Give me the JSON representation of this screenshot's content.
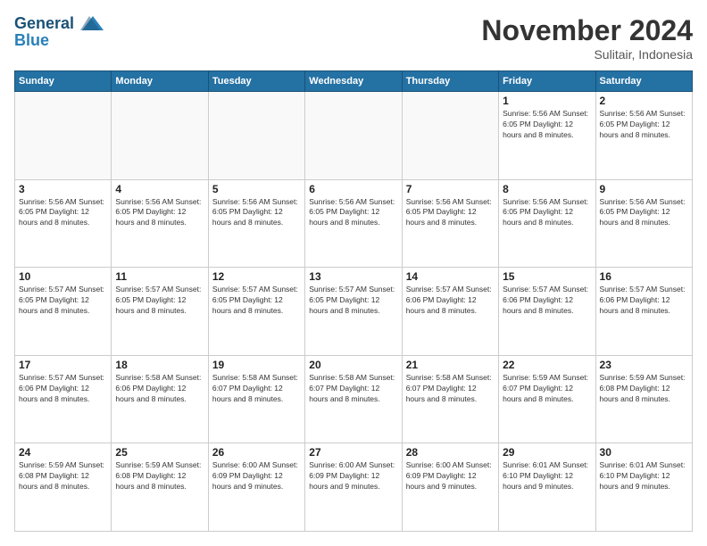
{
  "header": {
    "logo_line1": "General",
    "logo_line2": "Blue",
    "month": "November 2024",
    "location": "Sulitair, Indonesia"
  },
  "weekdays": [
    "Sunday",
    "Monday",
    "Tuesday",
    "Wednesday",
    "Thursday",
    "Friday",
    "Saturday"
  ],
  "weeks": [
    [
      {
        "day": "",
        "info": ""
      },
      {
        "day": "",
        "info": ""
      },
      {
        "day": "",
        "info": ""
      },
      {
        "day": "",
        "info": ""
      },
      {
        "day": "",
        "info": ""
      },
      {
        "day": "1",
        "info": "Sunrise: 5:56 AM\nSunset: 6:05 PM\nDaylight: 12 hours and 8 minutes."
      },
      {
        "day": "2",
        "info": "Sunrise: 5:56 AM\nSunset: 6:05 PM\nDaylight: 12 hours and 8 minutes."
      }
    ],
    [
      {
        "day": "3",
        "info": "Sunrise: 5:56 AM\nSunset: 6:05 PM\nDaylight: 12 hours and 8 minutes."
      },
      {
        "day": "4",
        "info": "Sunrise: 5:56 AM\nSunset: 6:05 PM\nDaylight: 12 hours and 8 minutes."
      },
      {
        "day": "5",
        "info": "Sunrise: 5:56 AM\nSunset: 6:05 PM\nDaylight: 12 hours and 8 minutes."
      },
      {
        "day": "6",
        "info": "Sunrise: 5:56 AM\nSunset: 6:05 PM\nDaylight: 12 hours and 8 minutes."
      },
      {
        "day": "7",
        "info": "Sunrise: 5:56 AM\nSunset: 6:05 PM\nDaylight: 12 hours and 8 minutes."
      },
      {
        "day": "8",
        "info": "Sunrise: 5:56 AM\nSunset: 6:05 PM\nDaylight: 12 hours and 8 minutes."
      },
      {
        "day": "9",
        "info": "Sunrise: 5:56 AM\nSunset: 6:05 PM\nDaylight: 12 hours and 8 minutes."
      }
    ],
    [
      {
        "day": "10",
        "info": "Sunrise: 5:57 AM\nSunset: 6:05 PM\nDaylight: 12 hours and 8 minutes."
      },
      {
        "day": "11",
        "info": "Sunrise: 5:57 AM\nSunset: 6:05 PM\nDaylight: 12 hours and 8 minutes."
      },
      {
        "day": "12",
        "info": "Sunrise: 5:57 AM\nSunset: 6:05 PM\nDaylight: 12 hours and 8 minutes."
      },
      {
        "day": "13",
        "info": "Sunrise: 5:57 AM\nSunset: 6:05 PM\nDaylight: 12 hours and 8 minutes."
      },
      {
        "day": "14",
        "info": "Sunrise: 5:57 AM\nSunset: 6:06 PM\nDaylight: 12 hours and 8 minutes."
      },
      {
        "day": "15",
        "info": "Sunrise: 5:57 AM\nSunset: 6:06 PM\nDaylight: 12 hours and 8 minutes."
      },
      {
        "day": "16",
        "info": "Sunrise: 5:57 AM\nSunset: 6:06 PM\nDaylight: 12 hours and 8 minutes."
      }
    ],
    [
      {
        "day": "17",
        "info": "Sunrise: 5:57 AM\nSunset: 6:06 PM\nDaylight: 12 hours and 8 minutes."
      },
      {
        "day": "18",
        "info": "Sunrise: 5:58 AM\nSunset: 6:06 PM\nDaylight: 12 hours and 8 minutes."
      },
      {
        "day": "19",
        "info": "Sunrise: 5:58 AM\nSunset: 6:07 PM\nDaylight: 12 hours and 8 minutes."
      },
      {
        "day": "20",
        "info": "Sunrise: 5:58 AM\nSunset: 6:07 PM\nDaylight: 12 hours and 8 minutes."
      },
      {
        "day": "21",
        "info": "Sunrise: 5:58 AM\nSunset: 6:07 PM\nDaylight: 12 hours and 8 minutes."
      },
      {
        "day": "22",
        "info": "Sunrise: 5:59 AM\nSunset: 6:07 PM\nDaylight: 12 hours and 8 minutes."
      },
      {
        "day": "23",
        "info": "Sunrise: 5:59 AM\nSunset: 6:08 PM\nDaylight: 12 hours and 8 minutes."
      }
    ],
    [
      {
        "day": "24",
        "info": "Sunrise: 5:59 AM\nSunset: 6:08 PM\nDaylight: 12 hours and 8 minutes."
      },
      {
        "day": "25",
        "info": "Sunrise: 5:59 AM\nSunset: 6:08 PM\nDaylight: 12 hours and 8 minutes."
      },
      {
        "day": "26",
        "info": "Sunrise: 6:00 AM\nSunset: 6:09 PM\nDaylight: 12 hours and 9 minutes."
      },
      {
        "day": "27",
        "info": "Sunrise: 6:00 AM\nSunset: 6:09 PM\nDaylight: 12 hours and 9 minutes."
      },
      {
        "day": "28",
        "info": "Sunrise: 6:00 AM\nSunset: 6:09 PM\nDaylight: 12 hours and 9 minutes."
      },
      {
        "day": "29",
        "info": "Sunrise: 6:01 AM\nSunset: 6:10 PM\nDaylight: 12 hours and 9 minutes."
      },
      {
        "day": "30",
        "info": "Sunrise: 6:01 AM\nSunset: 6:10 PM\nDaylight: 12 hours and 9 minutes."
      }
    ]
  ]
}
